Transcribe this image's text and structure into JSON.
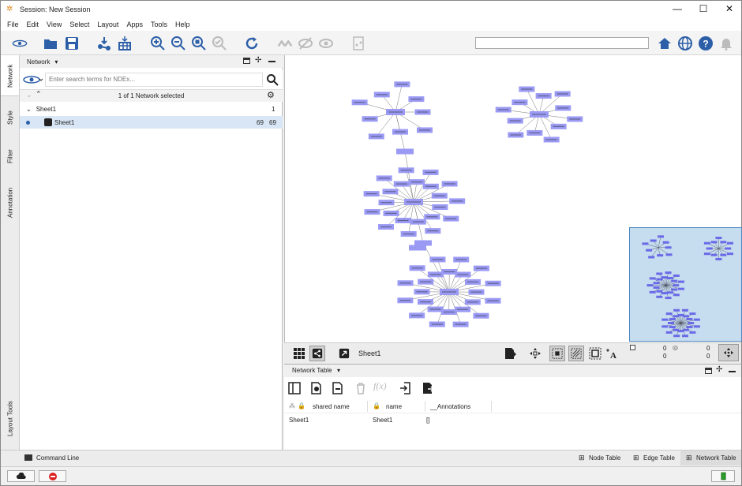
{
  "window": {
    "title": "Session: New Session",
    "minimize": "—",
    "maximize": "☐",
    "close": "✕"
  },
  "menu": [
    "File",
    "Edit",
    "View",
    "Select",
    "Layout",
    "Apps",
    "Tools",
    "Help"
  ],
  "side_tabs": {
    "network": "Network",
    "style": "Style",
    "filter": "Filter",
    "annotation": "Annotation",
    "layout_tools": "Layout Tools"
  },
  "network_panel": {
    "title": "Network",
    "dropdown": "▾",
    "search_placeholder": "Enter search terms for NDEx...",
    "selection_status": "1 of 1 Network selected",
    "collection": {
      "name": "Sheet1",
      "count": "1"
    },
    "network": {
      "name": "Sheet1",
      "nodes": "69",
      "edges": "69"
    }
  },
  "view_bar": {
    "network_name": "Sheet1",
    "counts": {
      "selected_nodes": "0",
      "selected_edges": "0",
      "hidden_nodes": "0",
      "hidden_edges": "0"
    }
  },
  "table_panel": {
    "title": "Network Table",
    "columns": [
      "shared name",
      "name",
      "__Annotations"
    ],
    "rows": [
      {
        "shared_name": "Sheet1",
        "name": "Sheet1",
        "annotations": "[]"
      }
    ]
  },
  "bottom_tabs": {
    "command_line": "Command Line",
    "node_table": "Node Table",
    "edge_table": "Edge Table",
    "network_table": "Network Table"
  },
  "colors": {
    "node": "#9a9af5",
    "accent": "#2c5fa8",
    "minimap": "#c6dcef",
    "selection": "#d8e6f6"
  }
}
